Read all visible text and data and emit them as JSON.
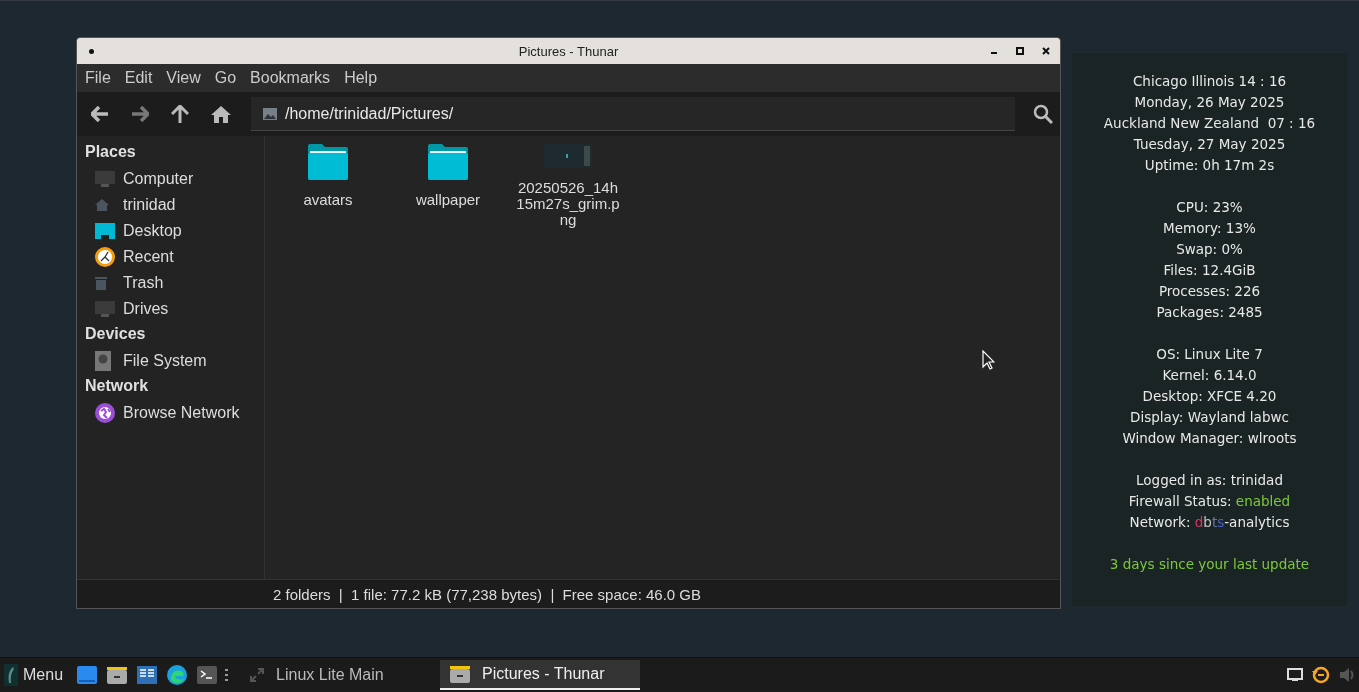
{
  "window": {
    "title": "Pictures - Thunar"
  },
  "menu": [
    "File",
    "Edit",
    "View",
    "Go",
    "Bookmarks",
    "Help"
  ],
  "toolbar": {
    "back_disabled": false,
    "forward_disabled": true
  },
  "location": {
    "value": "/home/trinidad/Pictures/"
  },
  "sidebar": [
    {
      "heading": "Places",
      "items": [
        {
          "label": "Computer",
          "kind": "computer"
        },
        {
          "label": "trinidad",
          "kind": "home"
        },
        {
          "label": "Desktop",
          "kind": "desktop"
        },
        {
          "label": "Recent",
          "kind": "recent"
        },
        {
          "label": "Trash",
          "kind": "trash"
        },
        {
          "label": "Drives",
          "kind": "computer"
        }
      ]
    },
    {
      "heading": "Devices",
      "items": [
        {
          "label": "File System",
          "kind": "drive"
        }
      ]
    },
    {
      "heading": "Network",
      "items": [
        {
          "label": "Browse Network",
          "kind": "network"
        }
      ]
    }
  ],
  "files": [
    {
      "name": "avatars",
      "kind": "folder"
    },
    {
      "name": "wallpaper",
      "kind": "folder"
    },
    {
      "name": "20250526_14h15m27s_grim.png",
      "kind": "image"
    }
  ],
  "status_bar": "2 folders  |  1 file: 77.2 kB (77,238 bytes)  |  Free space: 46.0 GB",
  "conky": [
    [
      {
        "parts": [
          {
            "text": "Chicago Illinois 14 : 16"
          }
        ]
      },
      {
        "parts": [
          {
            "text": "Monday, 26 May 2025"
          }
        ]
      },
      {
        "parts": [
          {
            "text": "Auckland New Zealand  07 : 16"
          }
        ]
      },
      {
        "parts": [
          {
            "text": "Tuesday, 27 May 2025"
          }
        ]
      },
      {
        "parts": [
          {
            "text": "Uptime: 0h 17m 2s"
          }
        ]
      }
    ],
    [
      {
        "parts": [
          {
            "text": "CPU: 23%"
          }
        ]
      },
      {
        "parts": [
          {
            "text": "Memory: 13%"
          }
        ]
      },
      {
        "parts": [
          {
            "text": "Swap: 0%"
          }
        ]
      },
      {
        "parts": [
          {
            "text": "Files: 12.4GiB"
          }
        ]
      },
      {
        "parts": [
          {
            "text": "Processes: 226"
          }
        ]
      },
      {
        "parts": [
          {
            "text": "Packages: 2485"
          }
        ]
      }
    ],
    [
      {
        "parts": [
          {
            "text": "OS: Linux Lite 7"
          }
        ]
      },
      {
        "parts": [
          {
            "text": "Kernel: 6.14.0"
          }
        ]
      },
      {
        "parts": [
          {
            "text": "Desktop: XFCE 4.20"
          }
        ]
      },
      {
        "parts": [
          {
            "text": "Display: Wayland labwc"
          }
        ]
      },
      {
        "parts": [
          {
            "text": "Window Manager: wlroots"
          }
        ]
      }
    ],
    [
      {
        "parts": [
          {
            "text": "Logged in as: trinidad"
          }
        ]
      },
      {
        "parts": [
          {
            "text": "Firewall Status: "
          },
          {
            "text": "enabled",
            "color": "#7cc93c"
          }
        ]
      },
      {
        "parts": [
          {
            "text": "Network: "
          },
          {
            "text": "d",
            "color": "#d8336b"
          },
          {
            "text": "b",
            "color": "#c8c8c8"
          },
          {
            "text": "t",
            "color": "#6b74a8"
          },
          {
            "text": "s",
            "color": "#4a5fd0"
          },
          {
            "text": "-analytics"
          }
        ]
      }
    ],
    [
      {
        "parts": [
          {
            "text": "3 days since your last update",
            "color": "#7cc93c"
          }
        ]
      }
    ]
  ],
  "taskbar": {
    "menu_label": "Menu",
    "launchers": [
      {
        "kind": "blue-window"
      },
      {
        "kind": "files"
      },
      {
        "kind": "notes"
      },
      {
        "kind": "browser"
      },
      {
        "kind": "terminal"
      }
    ],
    "tasks": [
      {
        "label": "Linux Lite Main",
        "selected": false,
        "kind": "workspace"
      },
      {
        "label": "Pictures - Thunar",
        "selected": true,
        "kind": "files"
      }
    ]
  }
}
